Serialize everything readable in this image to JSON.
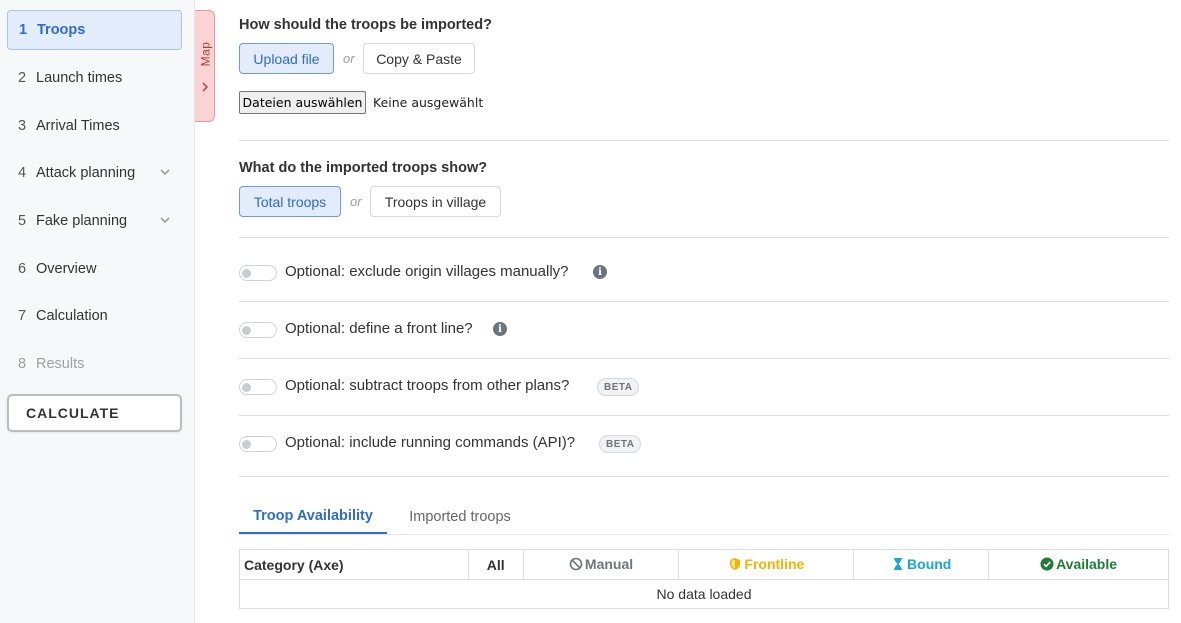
{
  "sidebar": {
    "items": [
      {
        "num": "1",
        "label": "Troops"
      },
      {
        "num": "2",
        "label": "Launch times"
      },
      {
        "num": "3",
        "label": "Arrival Times"
      },
      {
        "num": "4",
        "label": "Attack planning"
      },
      {
        "num": "5",
        "label": "Fake planning"
      },
      {
        "num": "6",
        "label": "Overview"
      },
      {
        "num": "7",
        "label": "Calculation"
      },
      {
        "num": "8",
        "label": "Results"
      }
    ],
    "calculate_label": "CALCULATE"
  },
  "map_tab": {
    "label": "Map"
  },
  "import": {
    "heading": "How should the troops be imported?",
    "upload_label": "Upload file",
    "or_label": "or",
    "paste_label": "Copy & Paste",
    "file_button_label": "Dateien auswählen",
    "file_status": "Keine ausgewählt"
  },
  "show": {
    "heading": "What do the imported troops show?",
    "total_label": "Total troops",
    "or_label": "or",
    "village_label": "Troops in village"
  },
  "options": [
    {
      "label": "Optional: exclude origin villages manually?",
      "badge": "info"
    },
    {
      "label": "Optional: define a front line?",
      "badge": "info"
    },
    {
      "label": "Optional: subtract troops from other plans?",
      "badge": "BETA"
    },
    {
      "label": "Optional: include running commands (API)?",
      "badge": "BETA"
    }
  ],
  "tabs": [
    {
      "label": "Troop Availability"
    },
    {
      "label": "Imported troops"
    }
  ],
  "table": {
    "headers": {
      "category": "Category (Axe)",
      "all": "All",
      "manual": "Manual",
      "frontline": "Frontline",
      "bound": "Bound",
      "available": "Available"
    },
    "empty_message": "No data loaded"
  },
  "colors": {
    "accent": "#2f6bd1",
    "frontline": "#f5b400",
    "bound": "#1aa7d8",
    "available": "#1e7d3b",
    "map_tab": "#fbd3d3"
  }
}
